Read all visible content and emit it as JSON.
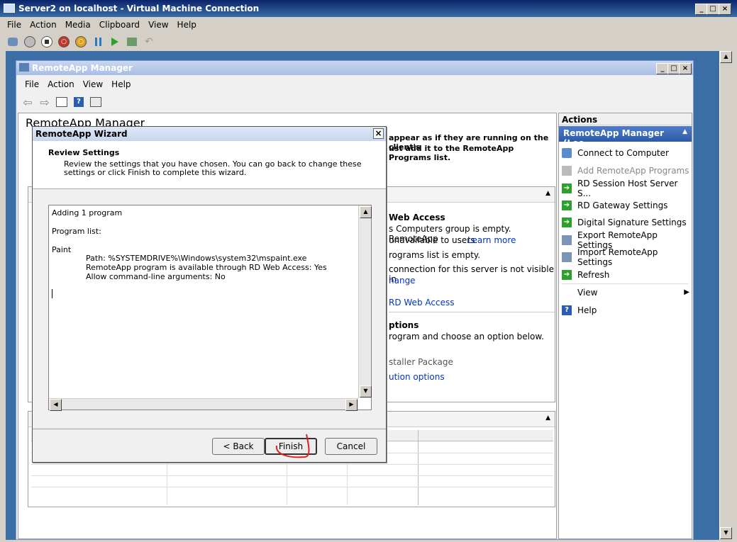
{
  "outer_window": {
    "title": "Server2 on localhost - Virtual Machine Connection",
    "menu": [
      "File",
      "Action",
      "Media",
      "Clipboard",
      "View",
      "Help"
    ]
  },
  "mmc": {
    "title": "RemoteApp Manager",
    "menu": [
      "File",
      "Action",
      "View",
      "Help"
    ],
    "page_title": "RemoteApp Manager",
    "intro_text": "appear as if they are running on the client's",
    "intro_text2": "ust add it to the RemoteApp Programs list.",
    "rdweb": {
      "heading": "Web Access",
      "line1": "s Computers group is empty. RemoteApp",
      "line2": "unavailable to users.",
      "learn_more": "Learn more",
      "line3": "rograms list is empty.",
      "line4": "connection for this server is not visible in",
      "change": "hange",
      "rd_web_access": "RD Web Access"
    },
    "options": {
      "heading": "ptions",
      "line1": "rogram and choose an option below.",
      "installer": "staller Package",
      "dist": "ution options"
    }
  },
  "actions": {
    "header": "Actions",
    "subheader": "RemoteApp Manager (Loc...",
    "items": [
      {
        "label": "Connect to Computer",
        "enabled": true
      },
      {
        "label": "Add RemoteApp Programs",
        "enabled": false
      },
      {
        "label": "RD Session Host Server S...",
        "enabled": true
      },
      {
        "label": "RD Gateway Settings",
        "enabled": true
      },
      {
        "label": "Digital Signature Settings",
        "enabled": true
      },
      {
        "label": "Export RemoteApp Settings",
        "enabled": true
      },
      {
        "label": "Import RemoteApp Settings",
        "enabled": true
      },
      {
        "label": "Refresh",
        "enabled": true
      },
      {
        "label": "View",
        "enabled": true
      },
      {
        "label": "Help",
        "enabled": true
      }
    ]
  },
  "wizard": {
    "title": "RemoteApp Wizard",
    "heading": "Review Settings",
    "desc1": "Review the settings that you have chosen. You can go back to change these",
    "desc2": "settings or click Finish to complete this wizard.",
    "summary": {
      "line1": "Adding 1 program",
      "line2": "Program list:",
      "line3": "Paint",
      "path": "Path: %SYSTEMDRIVE%\\Windows\\system32\\mspaint.exe",
      "rdweb": "RemoteApp program is available through RD Web Access: Yes",
      "cmdline": "Allow command-line arguments: No"
    },
    "buttons": {
      "back": "< Back",
      "finish": "Finish",
      "cancel": "Cancel"
    }
  },
  "icons": [
    "vm-settings-icon",
    "ctrl-alt-del-icon",
    "turn-off-icon",
    "shutdown-icon",
    "power-icon",
    "pause-icon",
    "resume-icon",
    "snapshot-icon",
    "revert-icon"
  ]
}
